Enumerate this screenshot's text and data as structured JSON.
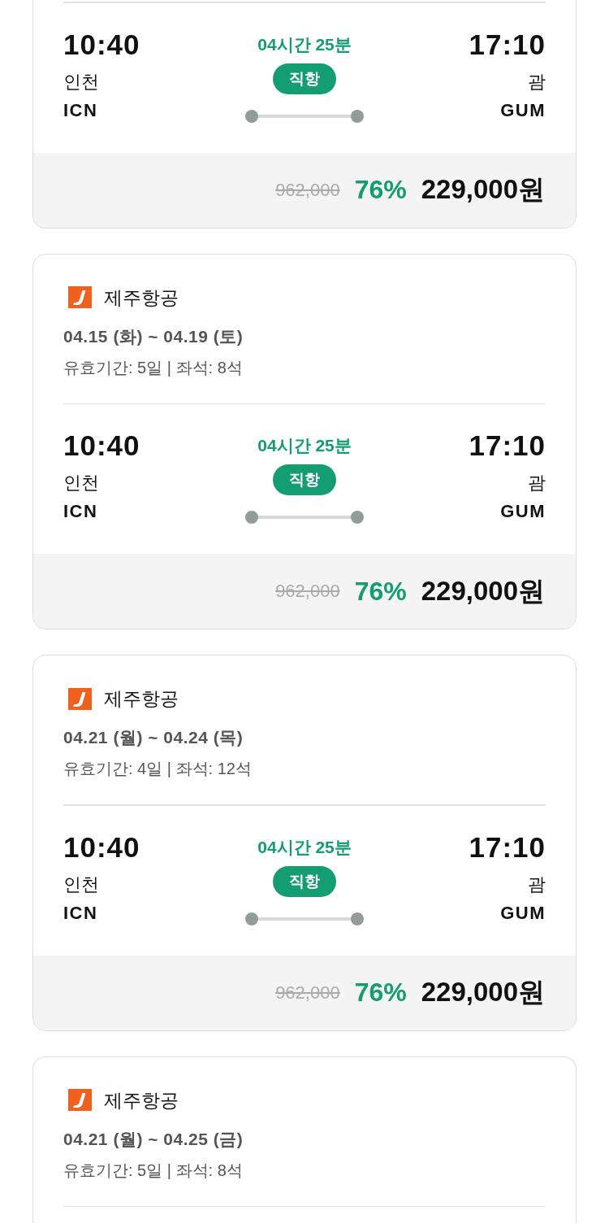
{
  "cards": [
    {
      "flight": {
        "depart_time": "10:40",
        "depart_city": "인천",
        "depart_code": "ICN",
        "duration": "04시간 25분",
        "route_type": "직항",
        "arrive_time": "17:10",
        "arrive_city": "괌",
        "arrive_code": "GUM"
      },
      "price": {
        "original": "962,000",
        "discount": "76%",
        "final": "229,000원"
      }
    },
    {
      "airline": "제주항공",
      "dates": "04.15 (화) ~ 04.19 (토)",
      "info": "유효기간: 5일 | 좌석: 8석",
      "flight": {
        "depart_time": "10:40",
        "depart_city": "인천",
        "depart_code": "ICN",
        "duration": "04시간 25분",
        "route_type": "직항",
        "arrive_time": "17:10",
        "arrive_city": "괌",
        "arrive_code": "GUM"
      },
      "price": {
        "original": "962,000",
        "discount": "76%",
        "final": "229,000원"
      }
    },
    {
      "airline": "제주항공",
      "dates": "04.21 (월) ~ 04.24 (목)",
      "info": "유효기간: 4일 | 좌석: 12석",
      "flight": {
        "depart_time": "10:40",
        "depart_city": "인천",
        "depart_code": "ICN",
        "duration": "04시간 25분",
        "route_type": "직항",
        "arrive_time": "17:10",
        "arrive_city": "괌",
        "arrive_code": "GUM"
      },
      "price": {
        "original": "962,000",
        "discount": "76%",
        "final": "229,000원"
      }
    },
    {
      "airline": "제주항공",
      "dates": "04.21 (월) ~ 04.25 (금)",
      "info": "유효기간: 5일 | 좌석: 8석"
    }
  ]
}
